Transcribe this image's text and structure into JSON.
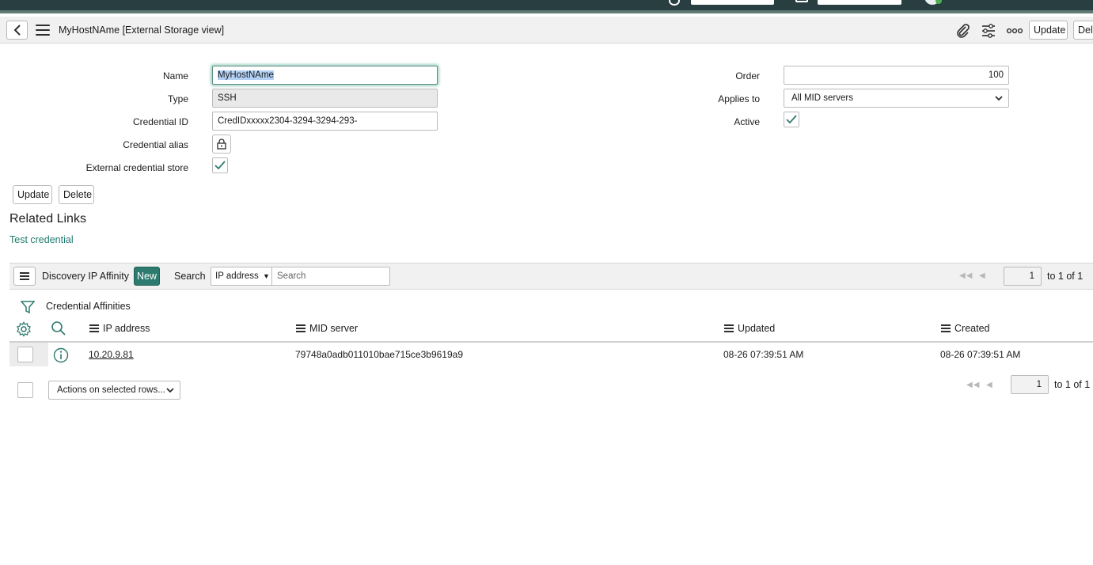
{
  "header": {
    "title": "MyHostNAme [External Storage view]",
    "update_label": "Update",
    "delete_label": "Delete"
  },
  "form": {
    "name": {
      "label": "Name",
      "value": "MyHostNAme"
    },
    "type": {
      "label": "Type",
      "value": "SSH"
    },
    "credential_id": {
      "label": "Credential ID",
      "value": "CredIDxxxxx2304-3294-3294-293-"
    },
    "credential_alias": {
      "label": "Credential alias"
    },
    "external_store": {
      "label": "External credential store",
      "checked": true
    },
    "order": {
      "label": "Order",
      "value": "100"
    },
    "applies_to": {
      "label": "Applies to",
      "value": "All MID servers"
    },
    "active": {
      "label": "Active",
      "checked": true
    },
    "update_label": "Update",
    "delete_label": "Delete"
  },
  "related": {
    "title": "Related Links",
    "link": "Test credential"
  },
  "list": {
    "title": "Discovery IP Affinity",
    "new_label": "New",
    "search_label": "Search",
    "search_field": "IP address",
    "search_placeholder": "Search",
    "page": "1",
    "page_text": "to 1 of 1",
    "breadcrumb": "Credential Affinities",
    "columns": [
      "IP address",
      "MID server",
      "Updated",
      "Created"
    ],
    "rows": [
      {
        "ip": "10.20.9.81",
        "mid": "79748a0adb011010bae715ce3b9619a9",
        "updated": "08-26 07:39:51 AM",
        "created": "08-26 07:39:51 AM"
      }
    ],
    "actions_label": "Actions on selected rows...",
    "footer_page": "1",
    "footer_page_text": "to 1 of 1"
  },
  "colors": {
    "topbar": "#293e40",
    "accent": "#2d7b6f",
    "link": "#1f7a6e"
  }
}
